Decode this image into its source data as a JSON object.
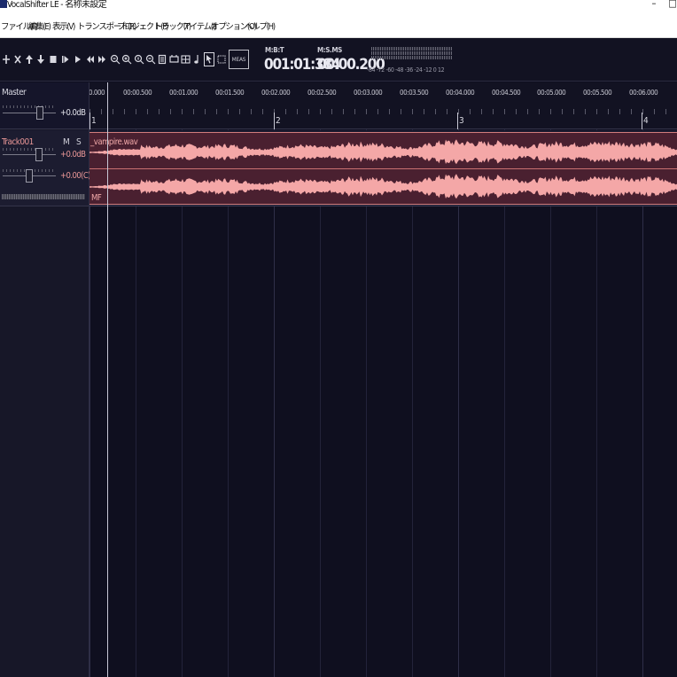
{
  "window": {
    "title": "VocalShifter LE - 名称未設定",
    "controls": {
      "minimize": "–",
      "maximize": "□"
    }
  },
  "menu": [
    {
      "id": "file",
      "label": "ファイル(F)"
    },
    {
      "id": "edit",
      "label": "編集(E)"
    },
    {
      "id": "view",
      "label": "表示(V)"
    },
    {
      "id": "transport",
      "label": "トランスポート(R)"
    },
    {
      "id": "project",
      "label": "プロジェクト(P)"
    },
    {
      "id": "track",
      "label": "トラック(T)"
    },
    {
      "id": "item",
      "label": "アイテム(I)"
    },
    {
      "id": "options",
      "label": "オプション(O)"
    },
    {
      "id": "help",
      "label": "ヘルプ(H)"
    }
  ],
  "toolbar": {
    "icons": [
      "add-icon",
      "delete-icon",
      "move-up-icon",
      "move-down-icon",
      "stop-icon",
      "play-icon",
      "play-from-start-icon",
      "rewind-icon",
      "fast-forward-icon",
      "zoom-in-horizontal-icon",
      "zoom-out-horizontal-icon",
      "zoom-in-vertical-icon",
      "zoom-out-vertical-icon",
      "loop-icon",
      "snap-icon",
      "grid-icon",
      "metronome-icon",
      "select-tool-icon",
      "range-tool-icon"
    ],
    "meas_label": "MEAS",
    "position": {
      "mbt_label": "M:B:T",
      "mbt_value": "001:01:384",
      "msms_label": "M:S.MS",
      "msms_value": "00:00.200"
    },
    "meter_scale": "-84 -72 -60 -48 -36 -24 -12  0  12"
  },
  "master": {
    "label": "Master",
    "volume": "+0.0dB"
  },
  "track": {
    "name": "Track001",
    "mute_label": "M",
    "solo_label": "S",
    "volume": "+0.0dB",
    "pan": "+0.00(C)"
  },
  "timeline": {
    "time_ticks": [
      "0.000",
      "00:00.500",
      "00:01.000",
      "00:01.500",
      "00:02.000",
      "00:02.500",
      "00:03.000",
      "00:03.500",
      "00:04.000",
      "00:04.500",
      "00:05.000",
      "00:05.500",
      "00:06.000"
    ],
    "measures": [
      "1",
      "2",
      "3",
      "4"
    ]
  },
  "clip": {
    "file_name": "_vampire.wav",
    "mode_label": "MF"
  },
  "colors": {
    "background": "#0f0f1f",
    "waveform": "#f4a7a7",
    "clip_fill": "#4a2030",
    "clip_border": "#d07c7c",
    "track_accent": "#e89696"
  }
}
